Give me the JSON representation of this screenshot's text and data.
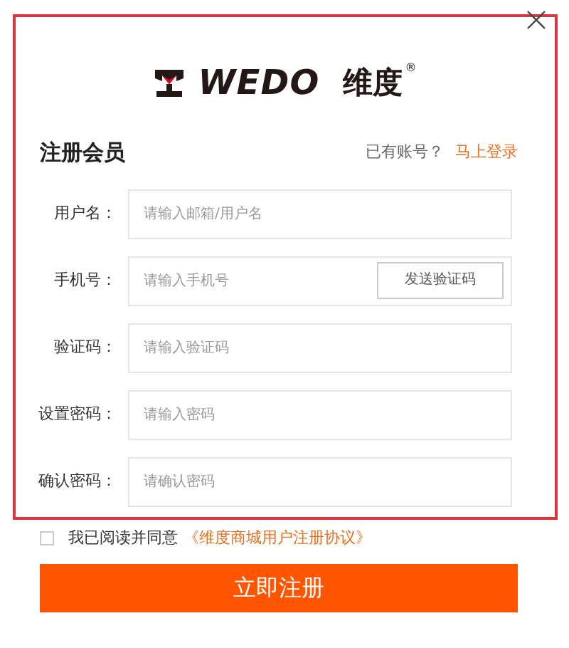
{
  "logo": {
    "wordmark": "WEDO",
    "chinese_name": "维度",
    "registered_mark": "®"
  },
  "title": "注册会员",
  "login_prompt": {
    "text": "已有账号？",
    "link": "马上登录"
  },
  "fields": [
    {
      "label": "用户名：",
      "placeholder": "请输入邮箱/用户名",
      "kind": "text"
    },
    {
      "label": "手机号：",
      "placeholder": "请输入手机号",
      "kind": "phone",
      "button": "发送验证码"
    },
    {
      "label": "验证码：",
      "placeholder": "请输入验证码",
      "kind": "text"
    },
    {
      "label": "设置密码：",
      "placeholder": "请输入密码",
      "kind": "password"
    },
    {
      "label": "确认密码：",
      "placeholder": "请确认密码",
      "kind": "password"
    }
  ],
  "agreement": {
    "checked": false,
    "text": "我已阅读并同意",
    "link": "《维度商城用户注册协议》"
  },
  "submit": "立即注册"
}
